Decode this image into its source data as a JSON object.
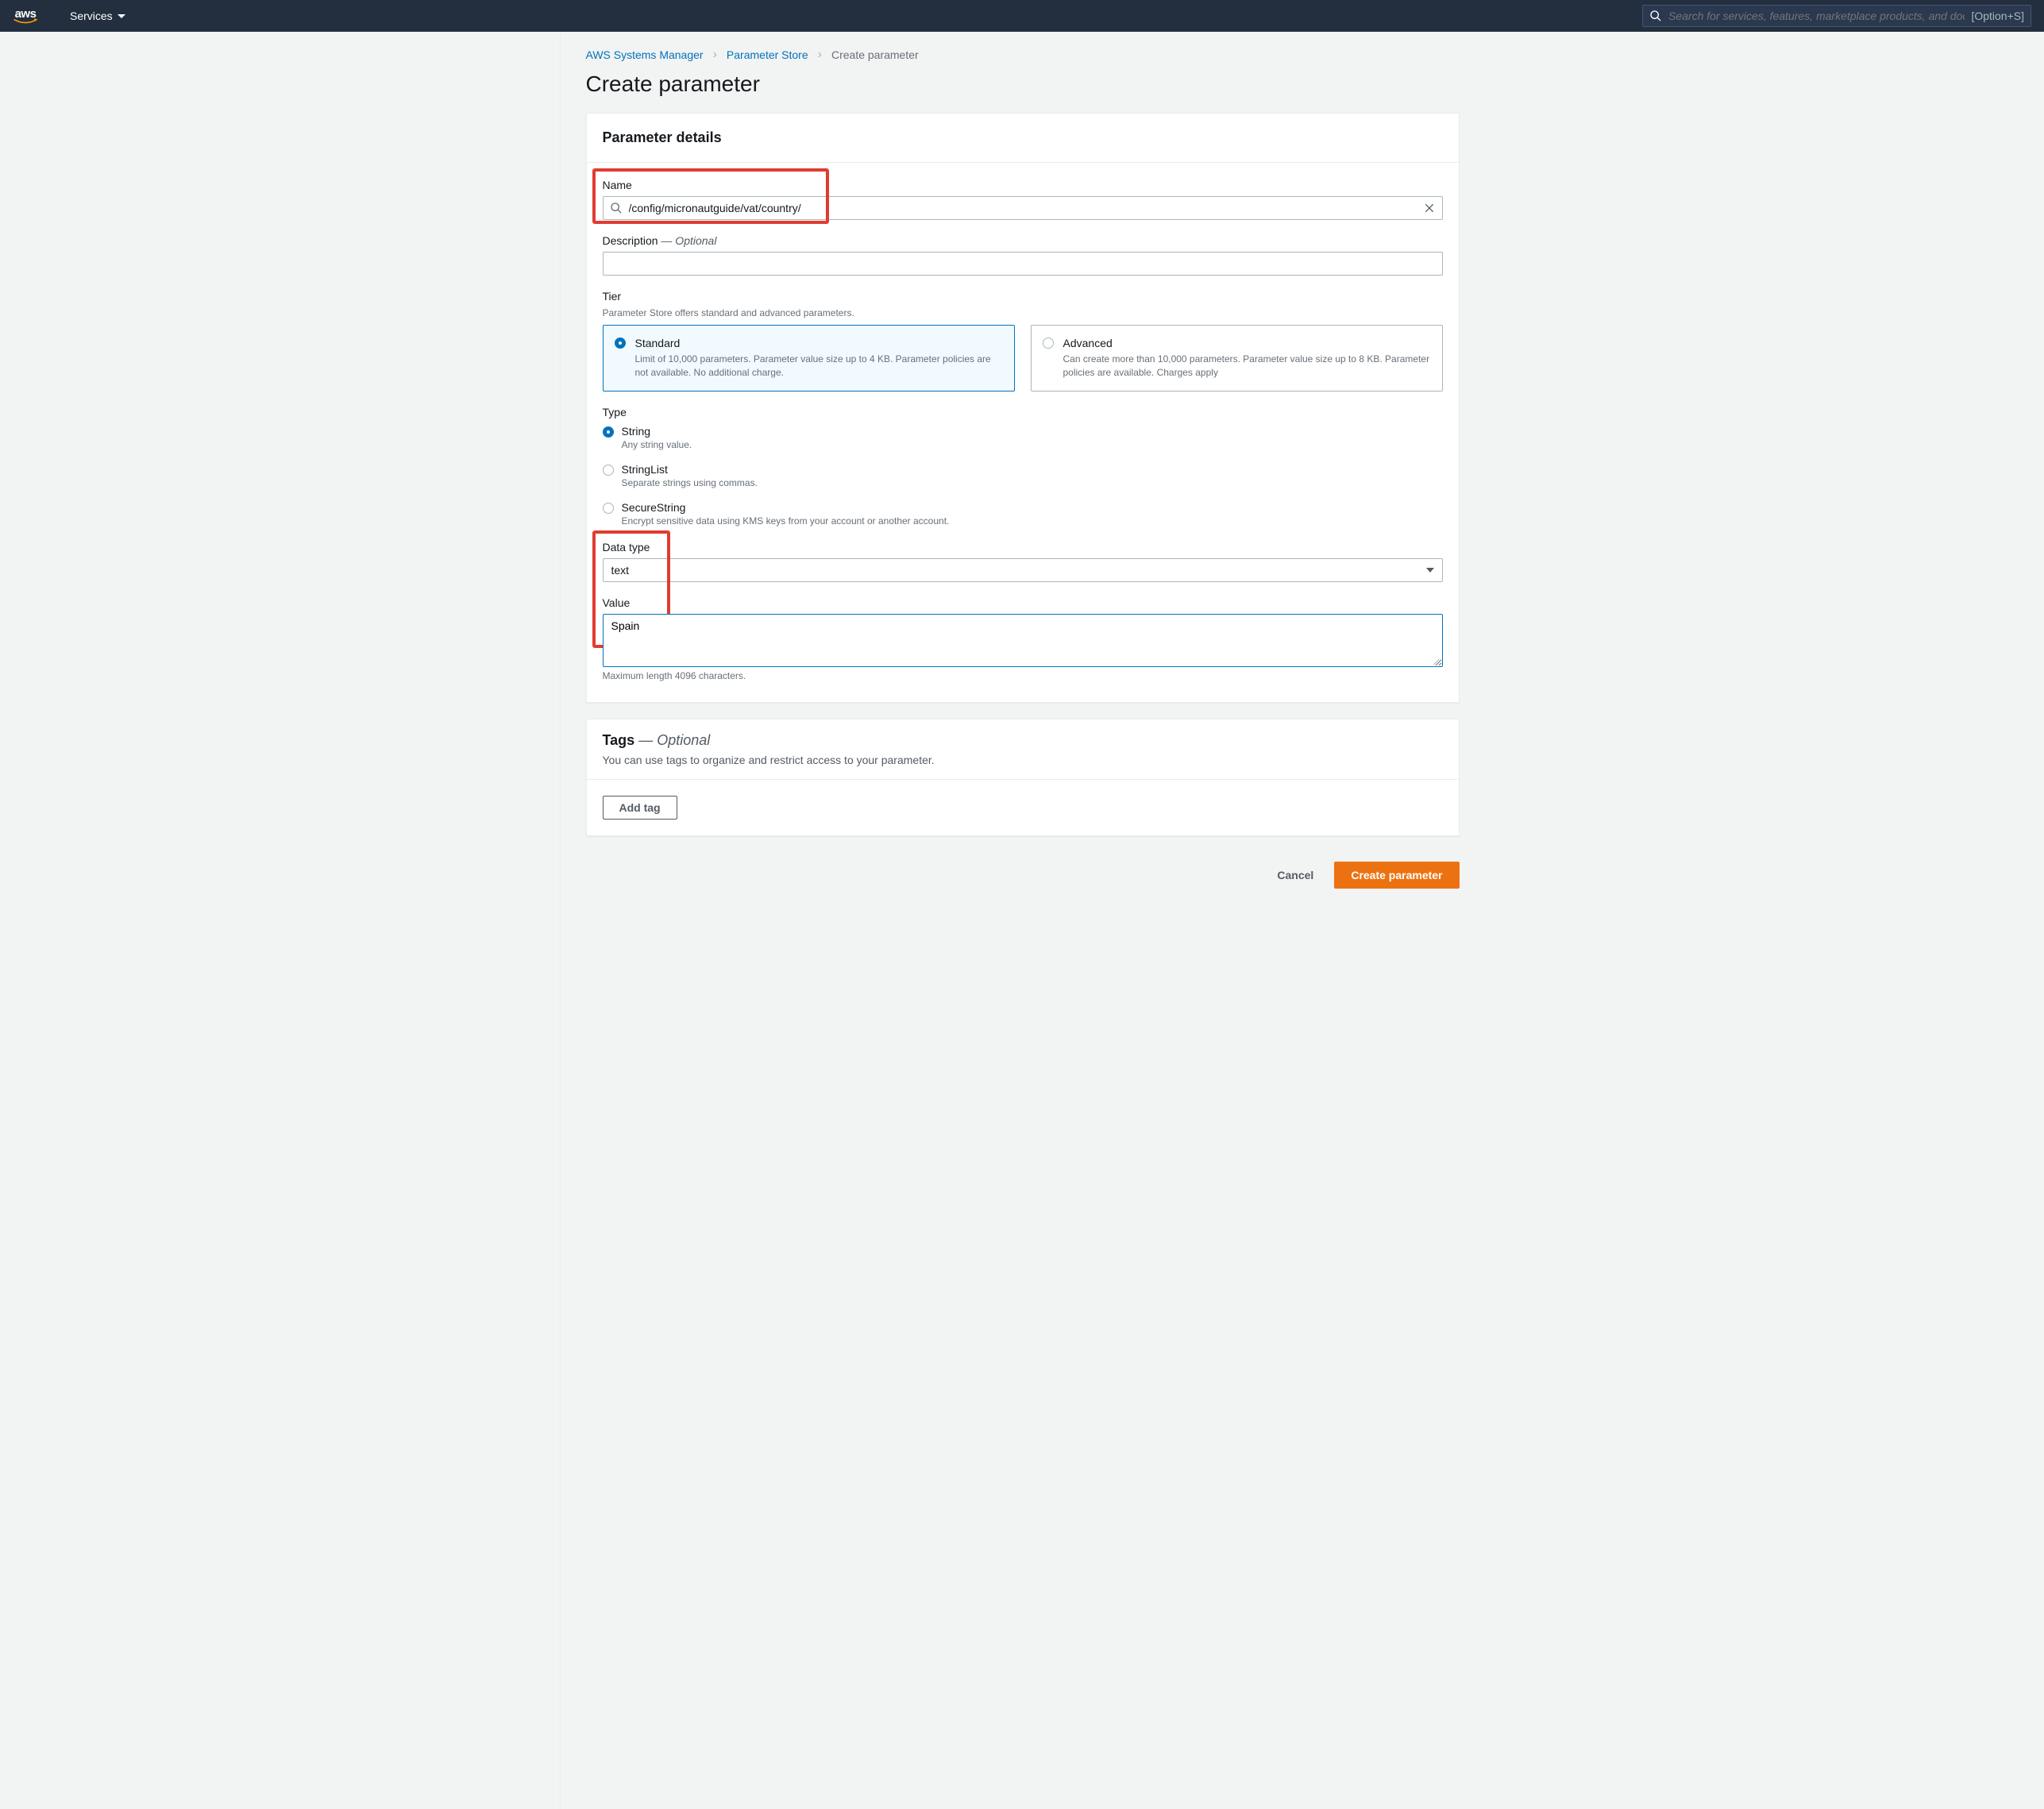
{
  "topnav": {
    "services_label": "Services",
    "search_placeholder": "Search for services, features, marketplace products, and docs",
    "search_shortcut": "[Option+S]"
  },
  "breadcrumb": {
    "root": "AWS Systems Manager",
    "level2": "Parameter Store",
    "current": "Create parameter"
  },
  "page": {
    "title": "Create parameter"
  },
  "panel_details": {
    "title": "Parameter details",
    "name_label": "Name",
    "name_value": "/config/micronautguide/vat/country/",
    "description_label": "Description",
    "description_optional": " — Optional",
    "description_value": "",
    "tier_label": "Tier",
    "tier_helper": "Parameter Store offers standard and advanced parameters.",
    "tier_standard_title": "Standard",
    "tier_standard_desc": "Limit of 10,000 parameters. Parameter value size up to 4 KB. Parameter policies are not available. No additional charge.",
    "tier_advanced_title": "Advanced",
    "tier_advanced_desc": "Can create more than 10,000 parameters. Parameter value size up to 8 KB. Parameter policies are available. Charges apply",
    "type_label": "Type",
    "type_string_title": "String",
    "type_string_desc": "Any string value.",
    "type_stringlist_title": "StringList",
    "type_stringlist_desc": "Separate strings using commas.",
    "type_securestring_title": "SecureString",
    "type_securestring_desc": "Encrypt sensitive data using KMS keys from your account or another account.",
    "datatype_label": "Data type",
    "datatype_value": "text",
    "value_label": "Value",
    "value_value": "Spain",
    "value_helper": "Maximum length 4096 characters."
  },
  "panel_tags": {
    "title": "Tags",
    "optional": " — Optional",
    "desc": "You can use tags to organize and restrict access to your parameter.",
    "add_tag_label": "Add tag"
  },
  "footer": {
    "cancel_label": "Cancel",
    "create_label": "Create parameter"
  }
}
